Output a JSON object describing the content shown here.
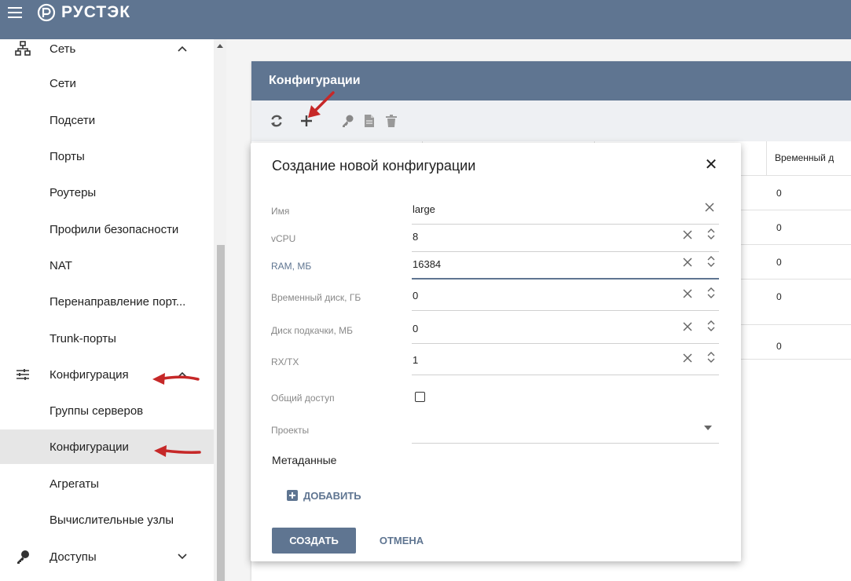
{
  "app": {
    "brand": "РУСТЭК"
  },
  "sidebar": {
    "items": [
      {
        "label": "Сеть",
        "icon": "network-icon",
        "expanded": true
      },
      {
        "label": "Сети"
      },
      {
        "label": "Подсети"
      },
      {
        "label": "Порты"
      },
      {
        "label": "Роутеры"
      },
      {
        "label": "Профили безопасности"
      },
      {
        "label": "NAT"
      },
      {
        "label": "Перенаправление порт..."
      },
      {
        "label": "Trunk-порты"
      },
      {
        "label": "Конфигурация",
        "icon": "sliders-icon",
        "expanded": true
      },
      {
        "label": "Группы серверов"
      },
      {
        "label": "Конфигурации",
        "active": true
      },
      {
        "label": "Агрегаты"
      },
      {
        "label": "Вычислительные узлы"
      },
      {
        "label": "Доступы",
        "icon": "key-icon",
        "expanded": false
      }
    ]
  },
  "panel": {
    "title": "Конфигурации",
    "column_header": "Временный д",
    "rows": [
      "0",
      "0",
      "0",
      "0",
      "0"
    ]
  },
  "dialog": {
    "title": "Создание новой конфигурации",
    "fields": [
      {
        "label": "Имя",
        "value": "large"
      },
      {
        "label": "vCPU",
        "value": "8"
      },
      {
        "label": "RAM, МБ",
        "value": "16384"
      },
      {
        "label": "Временный диск, ГБ",
        "value": "0"
      },
      {
        "label": "Диск подкачки, МБ",
        "value": "0"
      },
      {
        "label": "RX/TX",
        "value": "1"
      }
    ],
    "shared_label": "Общий доступ",
    "projects_label": "Проекты",
    "metadata_label": "Метаданные",
    "add_label": "ДОБАВИТЬ",
    "create_label": "СОЗДАТЬ",
    "cancel_label": "ОТМЕНА"
  },
  "colors": {
    "primary": "#5f7591",
    "arrow": "#c62828"
  }
}
